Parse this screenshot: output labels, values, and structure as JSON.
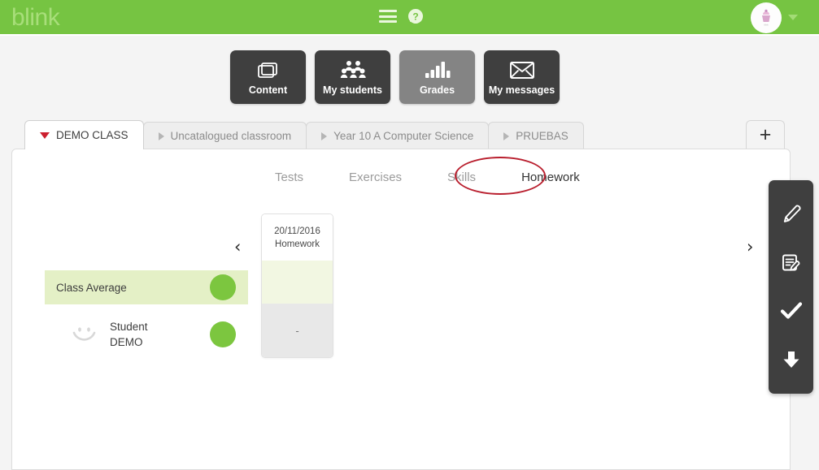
{
  "header": {
    "logo_text": "blink",
    "menu_icon": "hamburger-menu-icon",
    "help_icon": "help-question-icon",
    "avatar_icon": "user-avatar",
    "caret_icon": "chevron-down-icon"
  },
  "nav": {
    "buttons": [
      {
        "label": "Content",
        "icon": "content-windows-icon",
        "active": false
      },
      {
        "label": "My students",
        "icon": "students-group-icon",
        "active": false
      },
      {
        "label": "Grades",
        "icon": "bar-chart-icon",
        "active": true
      },
      {
        "label": "My messages",
        "icon": "envelope-icon",
        "active": false
      }
    ]
  },
  "tabs": {
    "items": [
      {
        "label": "DEMO CLASS",
        "active": true
      },
      {
        "label": "Uncatalogued classroom",
        "active": false
      },
      {
        "label": "Year 10 A Computer Science",
        "active": false
      },
      {
        "label": "PRUEBAS",
        "active": false
      }
    ],
    "add_label": "+"
  },
  "subtabs": {
    "items": [
      {
        "label": "Tests",
        "active": false
      },
      {
        "label": "Exercises",
        "active": false
      },
      {
        "label": "Skills",
        "active": false
      },
      {
        "label": "Homework",
        "active": true
      }
    ],
    "annotation": "red-ellipse-around-homework"
  },
  "gradebook": {
    "prev_label": "‹",
    "next_label": "›",
    "column": {
      "date": "20/11/2016",
      "type": "Homework",
      "average_value": "",
      "student_value": "-"
    },
    "rows": [
      {
        "name": "Class Average",
        "is_average": true,
        "status_color": "#7cc63f"
      },
      {
        "name_line1": "Student",
        "name_line2": "DEMO",
        "is_average": false,
        "status_color": "#7cc63f"
      }
    ]
  },
  "toolbar": {
    "tools": [
      {
        "icon": "pencil-edit-icon"
      },
      {
        "icon": "note-edit-icon"
      },
      {
        "icon": "checkmark-icon"
      },
      {
        "icon": "download-arrow-icon"
      }
    ]
  },
  "colors": {
    "brand_green": "#76c442",
    "status_green": "#7cc63f",
    "nav_dark": "#3f3f3f",
    "nav_active": "#848484",
    "annotation_red": "#b91f2e",
    "avg_row_bg": "#e4f0c6"
  }
}
